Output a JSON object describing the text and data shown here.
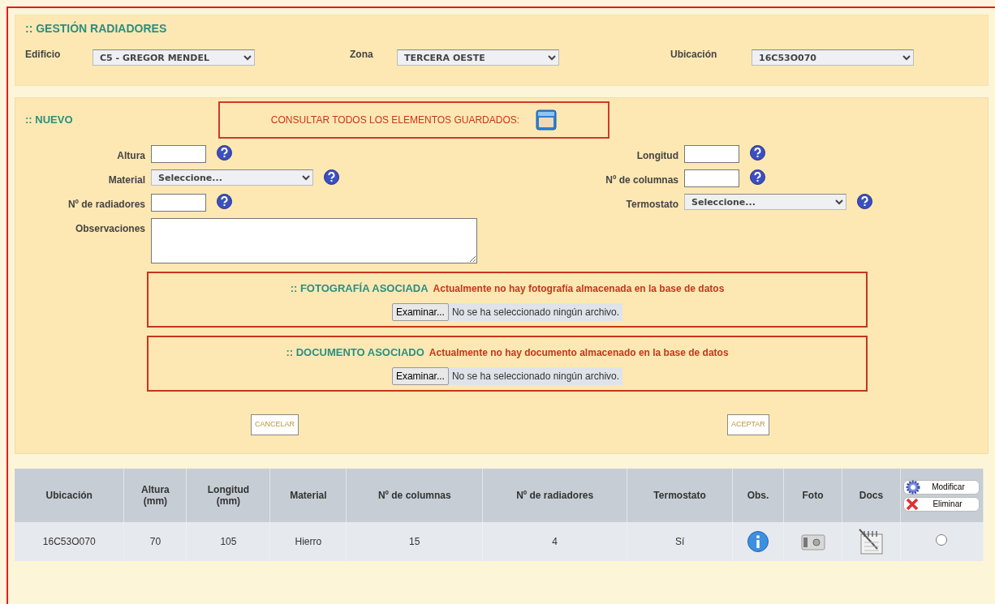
{
  "header": {
    "title": ":: GESTIÓN RADIADORES",
    "filters": [
      {
        "label": "Edificio",
        "value": "C5 - GREGOR MENDEL"
      },
      {
        "label": "Zona",
        "value": "TERCERA OESTE"
      },
      {
        "label": "Ubicación",
        "value": "16C53O070"
      }
    ]
  },
  "nuevo": {
    "title": ":: NUEVO",
    "consult_label": "CONSULTAR TODOS LOS ELEMENTOS GUARDADOS:",
    "fields_left": [
      {
        "label": "Altura",
        "kind": "input"
      },
      {
        "label": "Material",
        "kind": "select",
        "value": "Seleccione..."
      },
      {
        "label": "Nº de radiadores",
        "kind": "input"
      },
      {
        "label": "Observaciones",
        "kind": "textarea"
      }
    ],
    "fields_right": [
      {
        "label": "Longitud",
        "kind": "input"
      },
      {
        "label": "Nº de columnas",
        "kind": "input"
      },
      {
        "label": "Termostato",
        "kind": "select",
        "value": "Seleccione..."
      }
    ],
    "attachments": [
      {
        "title": ":: FOTOGRAFÍA ASOCIADA",
        "message": "Actualmente no hay fotografía almacenada en la base de datos",
        "button": "Examinar...",
        "file_status": "No se ha seleccionado ningún archivo."
      },
      {
        "title": ":: DOCUMENTO ASOCIADO",
        "message": "Actualmente no hay documento almacenado en la base de datos",
        "button": "Examinar...",
        "file_status": "No se ha seleccionado ningún archivo."
      }
    ],
    "buttons": [
      "CANCELAR",
      "ACEPTAR"
    ]
  },
  "table": {
    "columns": [
      "Ubicación",
      "Altura (mm)",
      "Longitud (mm)",
      "Material",
      "Nº de columnas",
      "Nº de radiadores",
      "Termostato",
      "Obs.",
      "Foto",
      "Docs"
    ],
    "actions": [
      {
        "label": "Modificar",
        "kind": "edit"
      },
      {
        "label": "Eliminar",
        "kind": "delete"
      }
    ],
    "rows": [
      {
        "cells": [
          "16C53O070",
          "70",
          "105",
          "Hierro",
          "15",
          "4",
          "Sí"
        ],
        "selected": false
      }
    ]
  }
}
